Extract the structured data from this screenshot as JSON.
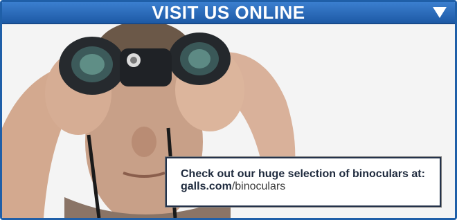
{
  "banner": {
    "title": "VISIT US ONLINE",
    "toggle_icon": "triangle-down-icon"
  },
  "photo": {
    "subject": "person-with-binoculars-image"
  },
  "callout": {
    "line1": "Check out our huge selection of binoculars at:",
    "link_domain": "galls.com",
    "link_path": "/binoculars"
  },
  "colors": {
    "banner_blue": "#2a6bbd",
    "frame_blue": "#1f5fa8",
    "text_dark": "#1e2a3d"
  }
}
